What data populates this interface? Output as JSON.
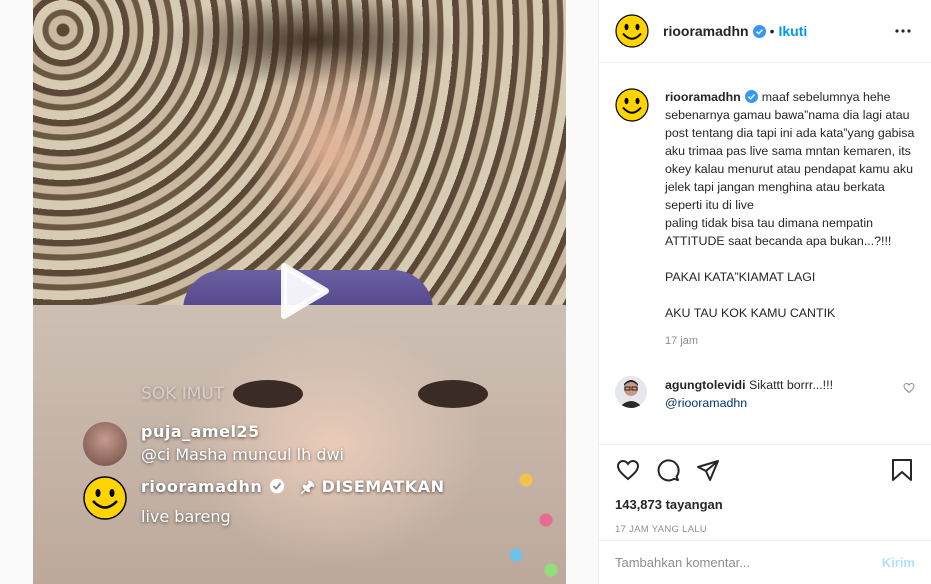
{
  "header": {
    "username": "riooramadhn",
    "separator": "•",
    "follow_label": "Ikuti"
  },
  "caption": {
    "username": "riooramadhn",
    "text": "maaf sebelumnya hehe sebenarnya gamau bawa”nama dia lagi atau post tentang dia tapi ini ada kata”yang gabisa aku trimaa pas live sama mntan kemaren, its okey kalau menurut atau pendapat kamu aku jelek tapi jangan menghina atau berkata seperti itu di live\npaling tidak bisa tau dimana nempatin ATTITUDE saat becanda apa bukan...?!!!\n\nPAKAI KATA”KIAMAT LAGI\n\nAKU TAU KOK KAMU CANTIK",
    "timestamp": "17 jam"
  },
  "comments": [
    {
      "username": "agungtolevidi",
      "text": "Sikattt borrr...!!!",
      "mention": "@riooramadhn"
    }
  ],
  "actions": {
    "views": "143,873 tayangan",
    "date": "17 JAM YANG LALU"
  },
  "add_comment": {
    "placeholder": "Tambahkan komentar...",
    "post_label": "Kirim"
  },
  "video_overlay": {
    "faded_text": "SOK IMUT",
    "comments": [
      {
        "username": "puja_amel25",
        "text": "@ci Masha muncul lh dwi"
      },
      {
        "username": "riooramadhn",
        "pinned": "🖈 DISEMATKAN",
        "text": "live bareng"
      }
    ]
  },
  "colors": {
    "accent": "#0095f6",
    "verified": "#3897f0",
    "smiley": "#ffd400"
  },
  "icons": [
    "smiley-avatar-icon",
    "verified-icon",
    "more-icon",
    "play-icon",
    "heart-icon",
    "comment-icon",
    "share-icon",
    "bookmark-icon"
  ]
}
